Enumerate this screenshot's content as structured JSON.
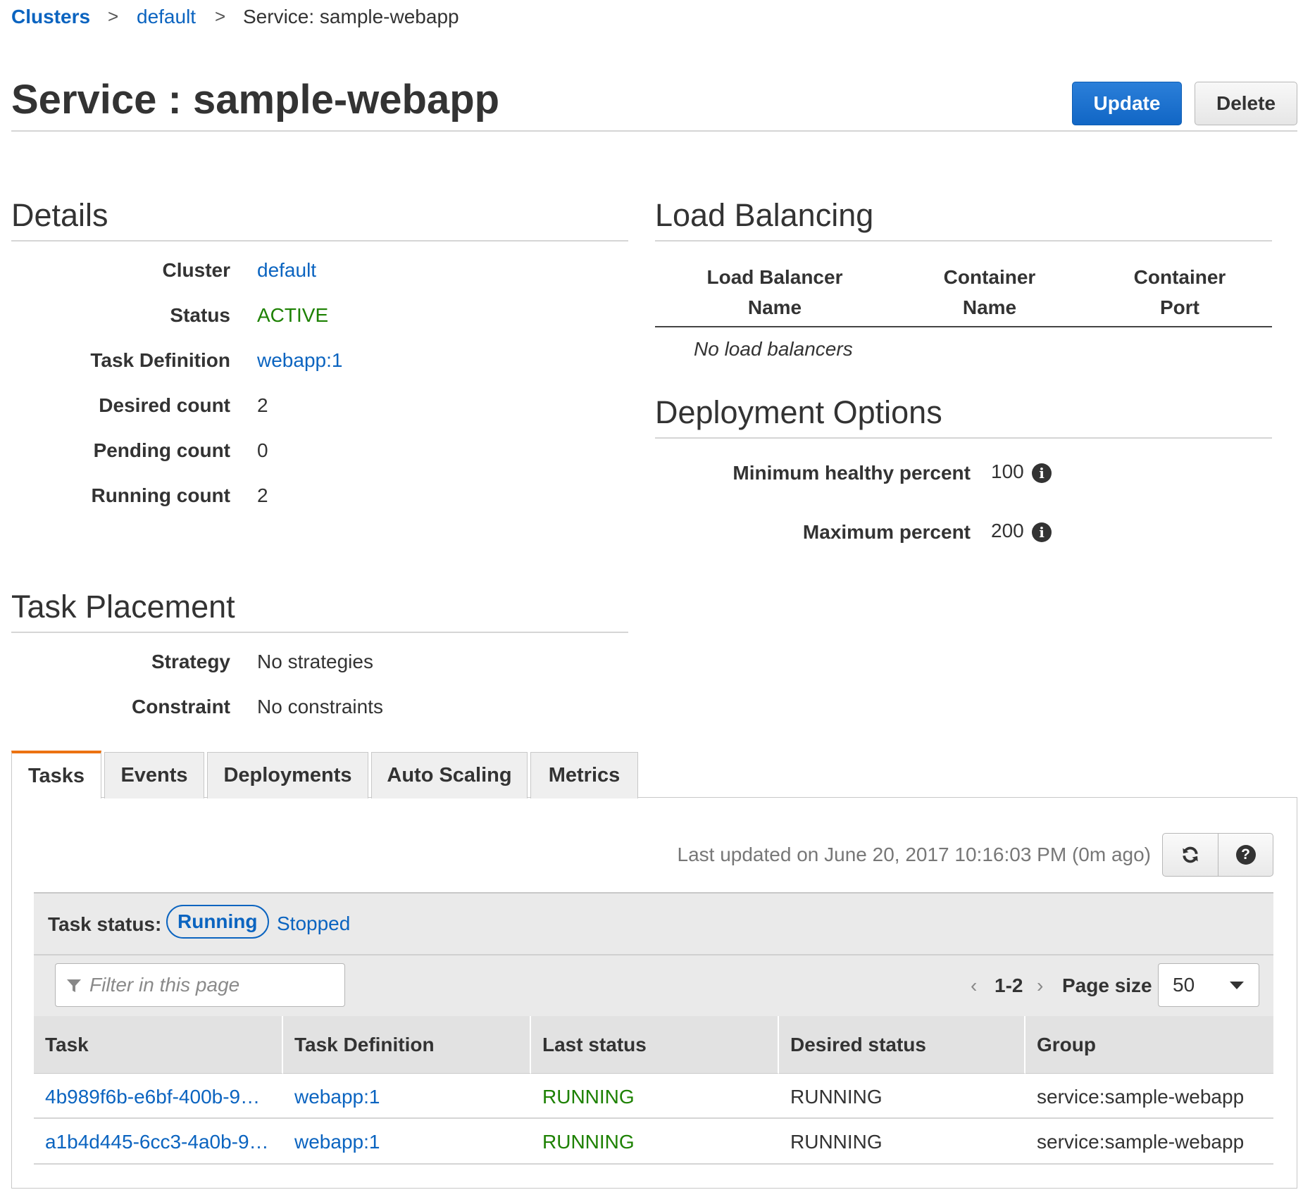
{
  "breadcrumb": {
    "items": [
      "Clusters",
      "default",
      "Service: sample-webapp"
    ],
    "separator": ">"
  },
  "header": {
    "title": "Service : sample-webapp",
    "update_label": "Update",
    "delete_label": "Delete"
  },
  "details": {
    "heading": "Details",
    "rows": [
      {
        "label": "Cluster",
        "value": "default"
      },
      {
        "label": "Status",
        "value": "ACTIVE"
      },
      {
        "label": "Task Definition",
        "value": "webapp:1"
      },
      {
        "label": "Desired count",
        "value": "2"
      },
      {
        "label": "Pending count",
        "value": "0"
      },
      {
        "label": "Running count",
        "value": "2"
      }
    ]
  },
  "load_balancing": {
    "heading": "Load Balancing",
    "columns": [
      {
        "line1": "Load Balancer",
        "line2": "Name"
      },
      {
        "line1": "Container",
        "line2": "Name"
      },
      {
        "line1": "Container",
        "line2": "Port"
      }
    ],
    "empty_text": "No load balancers"
  },
  "deployment_options": {
    "heading": "Deployment Options",
    "rows": [
      {
        "label": "Minimum healthy percent",
        "value": "100"
      },
      {
        "label": "Maximum percent",
        "value": "200"
      }
    ]
  },
  "task_placement": {
    "heading": "Task Placement",
    "rows": [
      {
        "label": "Strategy",
        "value": "No strategies"
      },
      {
        "label": "Constraint",
        "value": "No constraints"
      }
    ]
  },
  "tabs": [
    "Tasks",
    "Events",
    "Deployments",
    "Auto Scaling",
    "Metrics"
  ],
  "active_tab": "Tasks",
  "tasks_panel": {
    "last_updated": "Last updated on June 20, 2017 10:16:03 PM (0m ago)",
    "refresh_icon": "refresh-icon",
    "help_icon": "help-icon",
    "task_status_label": "Task status:",
    "status_running": "Running",
    "status_stopped": "Stopped",
    "filter_placeholder": "Filter in this page",
    "pagination": "1-2",
    "page_size_label": "Page size",
    "page_size_value": "50",
    "columns": [
      "Task",
      "Task Definition",
      "Last status",
      "Desired status",
      "Group"
    ],
    "rows": [
      [
        "4b989f6b-e6bf-400b-9…",
        "webapp:1",
        "RUNNING",
        "RUNNING",
        "service:sample-webapp"
      ],
      [
        "a1b4d445-6cc3-4a0b-9…",
        "webapp:1",
        "RUNNING",
        "RUNNING",
        "service:sample-webapp"
      ]
    ]
  },
  "colors": {
    "link": "#0b64c0",
    "status_green": "#1d8102",
    "primary_button": "#1166c5",
    "active_tab_accent": "#ec7211"
  }
}
